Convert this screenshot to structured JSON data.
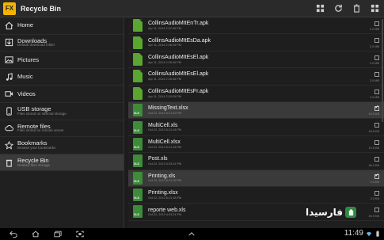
{
  "app": {
    "title": "Recycle Bin",
    "logo_text": "FX"
  },
  "sidebar": {
    "items": [
      {
        "label": "Home",
        "sub": "",
        "icon": "home-icon"
      },
      {
        "label": "Downloads",
        "sub": "Default download folder",
        "icon": "download-icon"
      },
      {
        "label": "Pictures",
        "sub": "",
        "icon": "picture-icon"
      },
      {
        "label": "Music",
        "sub": "",
        "icon": "music-icon"
      },
      {
        "label": "Videos",
        "sub": "",
        "icon": "video-icon"
      },
      {
        "label": "USB storage",
        "sub": "Files stored on internal storage",
        "icon": "phone-icon"
      },
      {
        "label": "Remote files",
        "sub": "Files stored on remote server",
        "icon": "cloud-icon"
      },
      {
        "label": "Bookmarks",
        "sub": "Browse your bookmarks",
        "icon": "star-icon"
      },
      {
        "label": "Recycle Bin",
        "sub": "Deleted files storage",
        "icon": "trash-icon",
        "selected": true
      }
    ]
  },
  "files": [
    {
      "name": "CollinsAudioMItEnTr.apk",
      "date": "Apr 11, 2014 2:27:06 PM",
      "size": "2.0 MB",
      "type": "apk",
      "checked": false
    },
    {
      "name": "CollinsAudioMItEsDa.apk",
      "date": "Apr 11, 2014 2:26:26 PM",
      "size": "2.0 MB",
      "type": "apk",
      "checked": false
    },
    {
      "name": "CollinsAudioMItEsEl.apk",
      "date": "Apr 11, 2014 2:25:46 PM",
      "size": "2.0 MB",
      "type": "apk",
      "checked": false
    },
    {
      "name": "CollinsAudioMItEsEl.apk",
      "date": "Apr 11, 2014 2:25:08 PM",
      "size": "2.0 MB",
      "type": "apk",
      "checked": false
    },
    {
      "name": "CollinsAudioMItEsFr.apk",
      "date": "Apr 11, 2014 2:24:26 PM",
      "size": "2.0 MB",
      "type": "apk",
      "checked": false
    },
    {
      "name": "MissingText.xlsx",
      "date": "Oct 22, 2013 6:21:10 PM",
      "size": "16.5 KB",
      "type": "xls",
      "checked": true
    },
    {
      "name": "MultiCell.xls",
      "date": "Oct 22, 2013 6:21:18 PM",
      "size": "18.5 KB",
      "type": "xls",
      "checked": false
    },
    {
      "name": "MultiCell.xlsx",
      "date": "Oct 22, 2013 6:21:18 PM",
      "size": "10.5 KB",
      "type": "xls",
      "checked": false
    },
    {
      "name": "Post.xls",
      "date": "Oct 22, 2013 4:03:24 PM",
      "size": "46.0 KB",
      "type": "xls",
      "checked": false
    },
    {
      "name": "Printing.xls",
      "date": "Oct 22, 2013 6:21:18 PM",
      "size": "2.0 KB",
      "type": "xls",
      "checked": true
    },
    {
      "name": "Printing.xlsx",
      "date": "Oct 22, 2013 6:21:18 PM",
      "size": "2.0 KB",
      "type": "xls",
      "checked": false
    },
    {
      "name": "reporte web.xls",
      "date": "Oct 22, 2013 4:03:24 PM",
      "size": "40.0 KB",
      "type": "xls",
      "checked": false
    }
  ],
  "watermark": {
    "text": "فارسیدا"
  },
  "status": {
    "time": "11:49"
  },
  "colors": {
    "accent": "#f4b400",
    "selected_bg": "#3a3a3a",
    "file_icon_green": "#3e8b3a"
  }
}
